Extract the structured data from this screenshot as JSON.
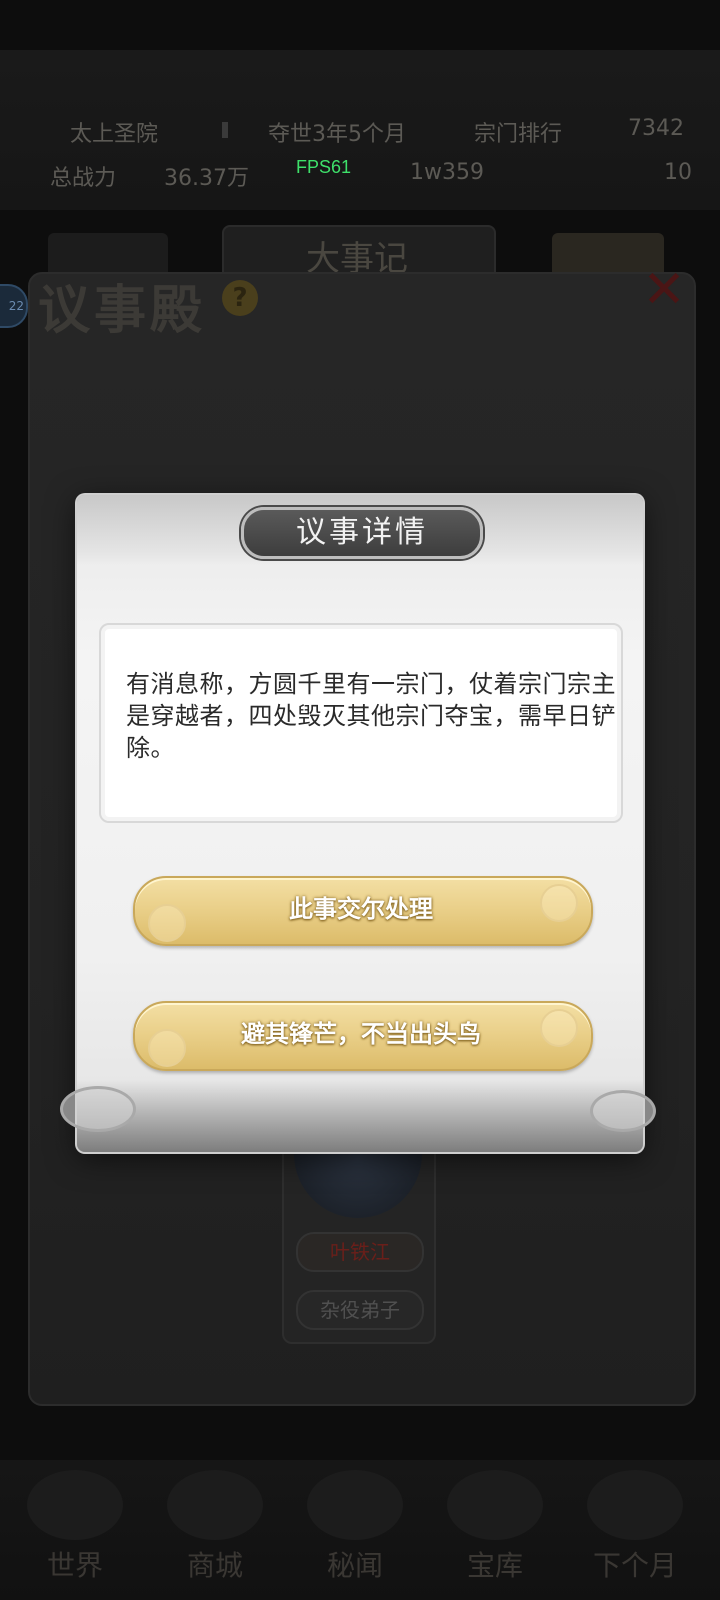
{
  "hud": {
    "sect_name": "太上圣院",
    "time_label": "夺世3年5个月",
    "rank_label": "宗门排行",
    "rank_value": "7342",
    "power_label": "总战力",
    "power_value": "36.37万",
    "stone_value": "1w359",
    "fps": "FPS61",
    "extra_value": "10"
  },
  "event_bar": {
    "title": "大事记"
  },
  "hall": {
    "title": "议事殿",
    "help_icon": "?",
    "close_icon": "close-icon",
    "badge": "22"
  },
  "character": {
    "name": "叶铁江",
    "role": "杂役弟子"
  },
  "bottom_nav": {
    "items": [
      "世界",
      "商城",
      "秘闻",
      "宝库",
      "下个月"
    ]
  },
  "modal": {
    "title": "议事详情",
    "description": "有消息称，方圆千里有一宗门，仗着宗门宗主是穿越者，四处毁灭其他宗门夺宝，需早日铲除。",
    "choices": [
      "此事交尔处理",
      "避其锋芒，不当出头鸟"
    ]
  },
  "colors": {
    "button_gold": "#ead08a",
    "title_pill": "#4a4a4a",
    "overlay": "#0d0d0d",
    "fps_green": "#3ee06a"
  }
}
